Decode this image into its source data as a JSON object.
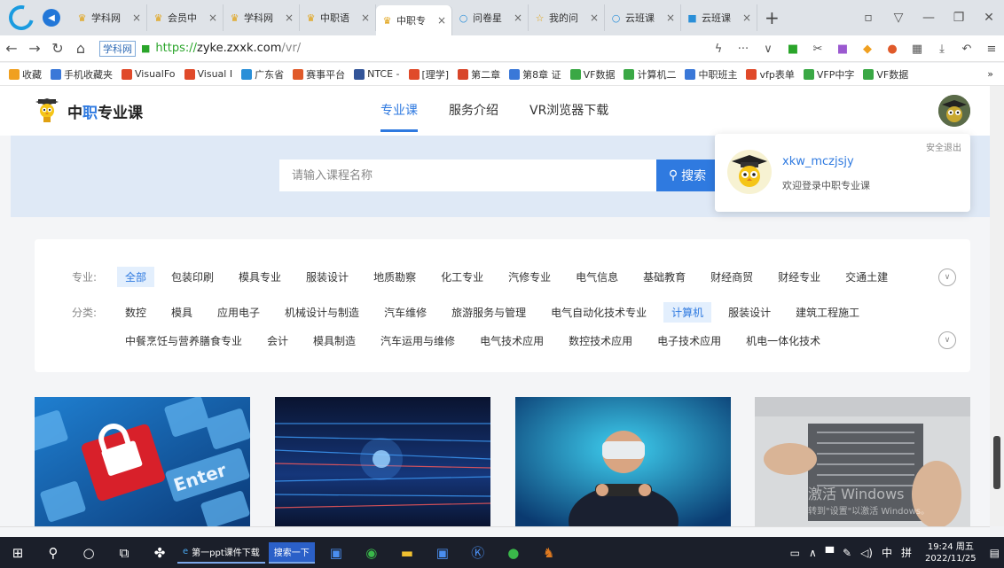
{
  "browser": {
    "tabs": [
      {
        "label": "学科网",
        "icon": "mascot-icon",
        "active": false
      },
      {
        "label": "会员中",
        "icon": "mascot-icon",
        "active": false
      },
      {
        "label": "学科网",
        "icon": "mascot-icon",
        "active": false
      },
      {
        "label": "中职语",
        "icon": "mascot-icon",
        "active": false
      },
      {
        "label": "中职专",
        "icon": "mascot-icon",
        "active": true
      },
      {
        "label": "问卷星",
        "icon": "search-icon",
        "active": false
      },
      {
        "label": "我的问",
        "icon": "star-icon",
        "active": false
      },
      {
        "label": "云班课",
        "icon": "search-icon",
        "active": false
      },
      {
        "label": "云班课",
        "icon": "cloud-icon",
        "active": false
      }
    ],
    "close_glyph": "×",
    "new_tab_glyph": "+",
    "address": {
      "site_badge": "学科网",
      "https": "https://",
      "domain": "zyke.zxxk.com",
      "path": "/vr/"
    },
    "bookmarks": [
      {
        "label": "收藏",
        "color": "#f0a020"
      },
      {
        "label": "手机收藏夹",
        "color": "#3a78d8"
      },
      {
        "label": "VisualFo",
        "color": "#e04a2a"
      },
      {
        "label": "Visual I",
        "color": "#e04a2a"
      },
      {
        "label": "广东省",
        "color": "#2a8fd8"
      },
      {
        "label": "赛事平台",
        "color": "#e05a2a"
      },
      {
        "label": "NTCE -",
        "color": "#335599"
      },
      {
        "label": "[理学]",
        "color": "#e04a2a"
      },
      {
        "label": "第二章",
        "color": "#d8452a"
      },
      {
        "label": "第8章 证",
        "color": "#3a78d8"
      },
      {
        "label": "VF数据",
        "color": "#3aa845"
      },
      {
        "label": "计算机二",
        "color": "#3aa845"
      },
      {
        "label": "中职班主",
        "color": "#3a78d8"
      },
      {
        "label": "vfp表单",
        "color": "#e04a2a"
      },
      {
        "label": "VFP中字",
        "color": "#3aa845"
      },
      {
        "label": "VF数据",
        "color": "#3aa845"
      }
    ],
    "bookmarks_more": "»"
  },
  "site": {
    "logo_prefix": "中",
    "logo_highlight": "职",
    "logo_suffix": "专业课",
    "nav": [
      {
        "label": "专业课",
        "active": true
      },
      {
        "label": "服务介绍",
        "active": false
      },
      {
        "label": "VR浏览器下载",
        "active": false
      }
    ],
    "search": {
      "placeholder": "请输入课程名称",
      "button_label": "搜索"
    },
    "user_popup": {
      "logout": "安全退出",
      "username": "xkw_mczjsjy",
      "welcome": "欢迎登录中职专业课"
    }
  },
  "filters": {
    "major_label": "专业:",
    "majors": [
      "全部",
      "包装印刷",
      "模具专业",
      "服装设计",
      "地质勘察",
      "化工专业",
      "汽修专业",
      "电气信息",
      "基础教育",
      "财经商贸",
      "财经专业",
      "交通土建"
    ],
    "major_selected": "全部",
    "category_label": "分类:",
    "categories_row1": [
      "数控",
      "模具",
      "应用电子",
      "机械设计与制造",
      "汽车维修",
      "旅游服务与管理",
      "电气自动化技术专业",
      "计算机",
      "服装设计",
      "建筑工程施工"
    ],
    "categories_row2": [
      "中餐烹饪与营养膳食专业",
      "会计",
      "模具制造",
      "汽车运用与维修",
      "电气技术应用",
      "数控技术应用",
      "电子技术应用",
      "机电一体化技术"
    ],
    "category_selected": "计算机"
  },
  "cards": [
    {
      "name": "security-lock-keyboard",
      "overlay": "Enter"
    },
    {
      "name": "server-circuit"
    },
    {
      "name": "vr-headset-gamer"
    },
    {
      "name": "hardware-cpu-fan",
      "watermark": "激活 Windows",
      "watermark_sub": "转到\"设置\"以激活 Windows。"
    }
  ],
  "taskbar": {
    "apps": [
      {
        "label": "第一ppt课件下载"
      },
      {
        "label": "搜索一下"
      }
    ],
    "ime": "中",
    "ime2": "拼",
    "clock_time": "19:24 周五",
    "clock_date": "2022/11/25"
  }
}
